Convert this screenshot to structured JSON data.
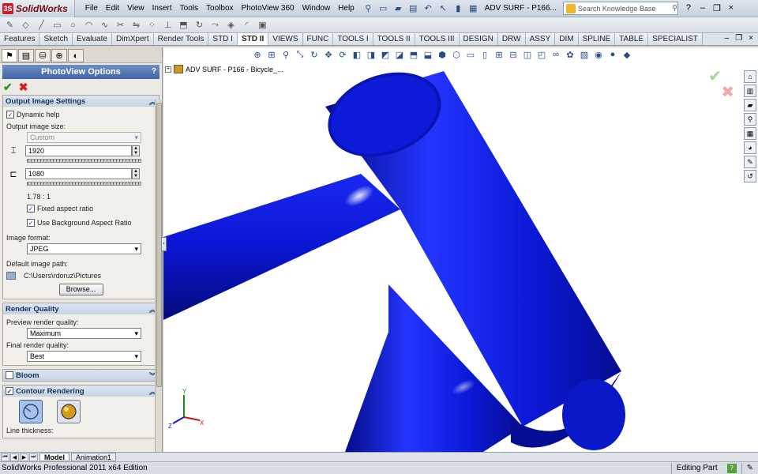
{
  "app": {
    "logo_text": "SolidWorks",
    "menus": [
      "File",
      "Edit",
      "View",
      "Insert",
      "Tools",
      "Toolbox",
      "PhotoView 360",
      "Window",
      "Help"
    ],
    "document_title": "ADV SURF - P166...",
    "search_placeholder": "Search Knowledge Base"
  },
  "command_tabs": [
    "Features",
    "Sketch",
    "Evaluate",
    "DimXpert",
    "Render Tools",
    "STD I",
    "STD II",
    "VIEWS",
    "FUNC",
    "TOOLS I",
    "TOOLS II",
    "TOOLS III",
    "DESIGN",
    "DRW",
    "ASSY",
    "DIM",
    "SPLINE",
    "TABLE",
    "SPECIALIST"
  ],
  "active_command_tab": "STD II",
  "panel": {
    "title": "PhotoView Options",
    "help": "?",
    "output": {
      "header": "Output Image Settings",
      "dynamic_help": "Dynamic help",
      "size_label": "Output image size:",
      "size_value": "Custom",
      "width": "1920",
      "height": "1080",
      "ratio": "1.78 : 1",
      "fixed_aspect": "Fixed aspect ratio",
      "bg_aspect": "Use Background Aspect Ratio",
      "format_label": "Image format:",
      "format_value": "JPEG",
      "path_label": "Default image path:",
      "path_value": "C:\\Users\\rdoruz\\Pictures",
      "browse": "Browse..."
    },
    "quality": {
      "header": "Render Quality",
      "preview_label": "Preview render quality:",
      "preview_value": "Maximum",
      "final_label": "Final render quality:",
      "final_value": "Best"
    },
    "bloom": {
      "header": "Bloom"
    },
    "contour": {
      "header": "Contour Rendering",
      "line_label": "Line thickness:"
    }
  },
  "viewport": {
    "tree_root": "ADV SURF - P166 - Bicycle_...",
    "model_color": "#0b16d6"
  },
  "bottom_tabs": [
    "Model",
    "Animation1"
  ],
  "status": {
    "left": "SolidWorks Professional 2011 x64 Edition",
    "mode": "Editing Part",
    "help": "?"
  }
}
